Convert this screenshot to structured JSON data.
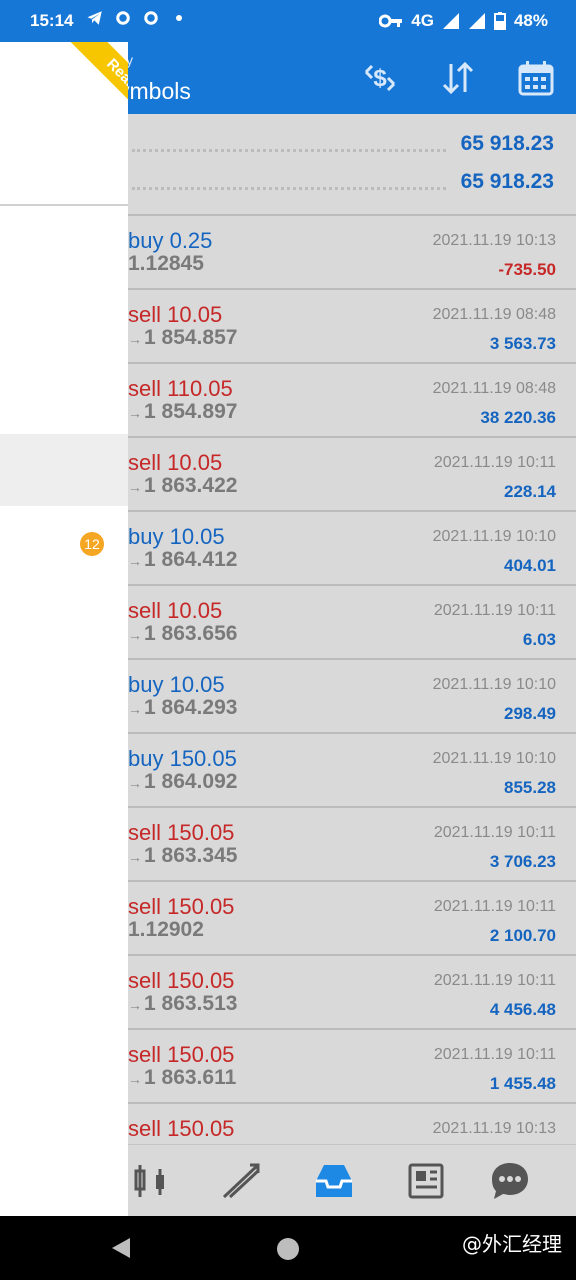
{
  "status_bar": {
    "time": "15:14",
    "network": "4G",
    "battery": "48%",
    "icons": [
      "telegram-icon",
      "chat-icon",
      "chat-icon",
      "dot-icon",
      "key-icon",
      "signal-icon",
      "battery-icon"
    ]
  },
  "header": {
    "subtitle": "y",
    "title": "ymbols",
    "actions": [
      "currency-exchange-icon",
      "sort-icon",
      "calendar-icon"
    ]
  },
  "balance": {
    "rows": [
      "65 918.23",
      "65 918.23"
    ]
  },
  "trades": [
    {
      "side": "buy",
      "label": "buy 0.25",
      "price": "1.12845",
      "arrow": false,
      "time": "2021.11.19 10:13",
      "profit": "-735.50",
      "profit_sign": "neg"
    },
    {
      "side": "sell",
      "label": "sell 10.05",
      "price": "1 854.857",
      "arrow": true,
      "time": "2021.11.19 08:48",
      "profit": "3 563.73",
      "profit_sign": "pos"
    },
    {
      "side": "sell",
      "label": "sell 110.05",
      "price": "1 854.897",
      "arrow": true,
      "time": "2021.11.19 08:48",
      "profit": "38 220.36",
      "profit_sign": "pos"
    },
    {
      "side": "sell",
      "label": "sell 10.05",
      "price": "1 863.422",
      "arrow": true,
      "time": "2021.11.19 10:11",
      "profit": "228.14",
      "profit_sign": "pos"
    },
    {
      "side": "buy",
      "label": "buy 10.05",
      "price": "1 864.412",
      "arrow": true,
      "time": "2021.11.19 10:10",
      "profit": "404.01",
      "profit_sign": "pos"
    },
    {
      "side": "sell",
      "label": "sell 10.05",
      "price": "1 863.656",
      "arrow": true,
      "time": "2021.11.19 10:11",
      "profit": "6.03",
      "profit_sign": "pos"
    },
    {
      "side": "buy",
      "label": "buy 10.05",
      "price": "1 864.293",
      "arrow": true,
      "time": "2021.11.19 10:10",
      "profit": "298.49",
      "profit_sign": "pos"
    },
    {
      "side": "buy",
      "label": "buy 150.05",
      "price": "1 864.092",
      "arrow": true,
      "time": "2021.11.19 10:10",
      "profit": "855.28",
      "profit_sign": "pos"
    },
    {
      "side": "sell",
      "label": "sell 150.05",
      "price": "1 863.345",
      "arrow": true,
      "time": "2021.11.19 10:11",
      "profit": "3 706.23",
      "profit_sign": "pos"
    },
    {
      "side": "sell",
      "label": "sell 150.05",
      "price": "1.12902",
      "arrow": false,
      "time": "2021.11.19 10:11",
      "profit": "2 100.70",
      "profit_sign": "pos"
    },
    {
      "side": "sell",
      "label": "sell 150.05",
      "price": "1 863.513",
      "arrow": true,
      "time": "2021.11.19 10:11",
      "profit": "4 456.48",
      "profit_sign": "pos"
    },
    {
      "side": "sell",
      "label": "sell 150.05",
      "price": "1 863.611",
      "arrow": true,
      "time": "2021.11.19 10:11",
      "profit": "1 455.48",
      "profit_sign": "pos"
    },
    {
      "side": "sell",
      "label": "sell 150.05",
      "price": "",
      "arrow": false,
      "time": "2021.11.19 10:13",
      "profit": "",
      "profit_sign": "pos"
    }
  ],
  "bottom_nav": [
    "candles-icon",
    "chart-icon",
    "trade-inbox-icon",
    "news-icon",
    "chat-icon"
  ],
  "drawer": {
    "ribbon": "Real",
    "badge": "12"
  },
  "watermark": "@外汇经理",
  "colors": {
    "accent": "#1777d6",
    "buy": "#1565c0",
    "sell": "#c62828"
  }
}
